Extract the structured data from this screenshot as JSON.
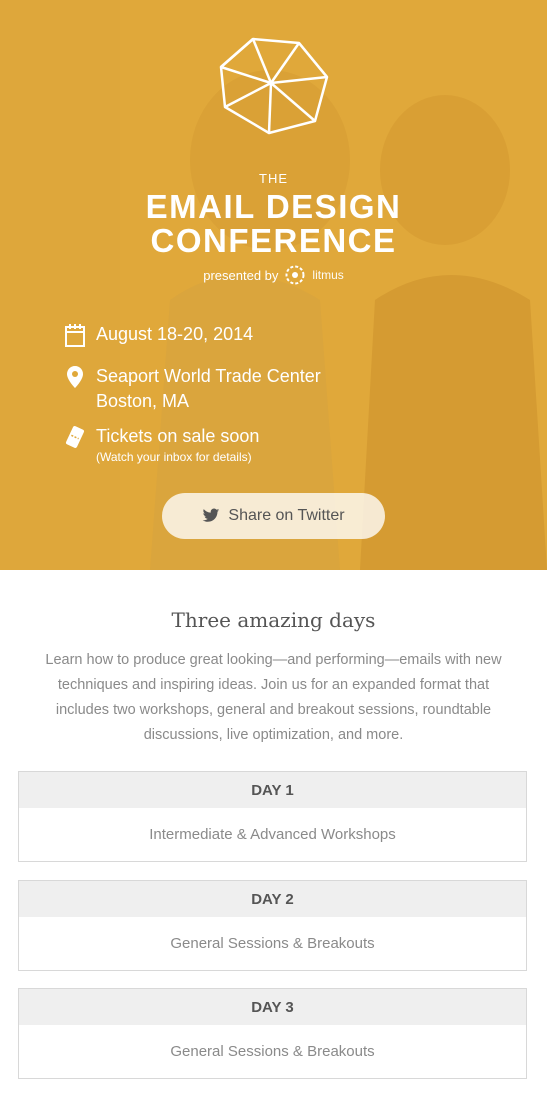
{
  "hero": {
    "the": "THE",
    "title_line1": "EMAIL DESIGN",
    "title_line2": "CONFERENCE",
    "presented_by": "presented by",
    "sponsor": "litmus",
    "colors": {
      "overlay": "#e0a83a",
      "text": "#ffffff"
    }
  },
  "event": {
    "date": "August 18-20, 2014",
    "venue_line1": "Seaport World Trade Center",
    "venue_line2": "Boston, MA",
    "tickets": "Tickets on sale soon",
    "tickets_note": "(Watch your inbox for details)"
  },
  "share": {
    "label": "Share on Twitter"
  },
  "about": {
    "title": "Three amazing days",
    "description": "Learn how to produce great looking—and performing—emails with new techniques and inspiring ideas. Join us for an expanded format that includes two workshops, general and breakout sessions, roundtable discussions, live optimization, and more."
  },
  "days": [
    {
      "label": "DAY 1",
      "desc": "Intermediate & Advanced Workshops"
    },
    {
      "label": "DAY 2",
      "desc": "General Sessions & Breakouts"
    },
    {
      "label": "DAY 3",
      "desc": "General Sessions & Breakouts"
    }
  ],
  "icons": {
    "logo": "geodesic-logo-icon",
    "calendar": "calendar-icon",
    "location": "map-pin-icon",
    "ticket": "ticket-icon",
    "twitter": "twitter-bird-icon",
    "litmus": "litmus-logo-icon"
  }
}
